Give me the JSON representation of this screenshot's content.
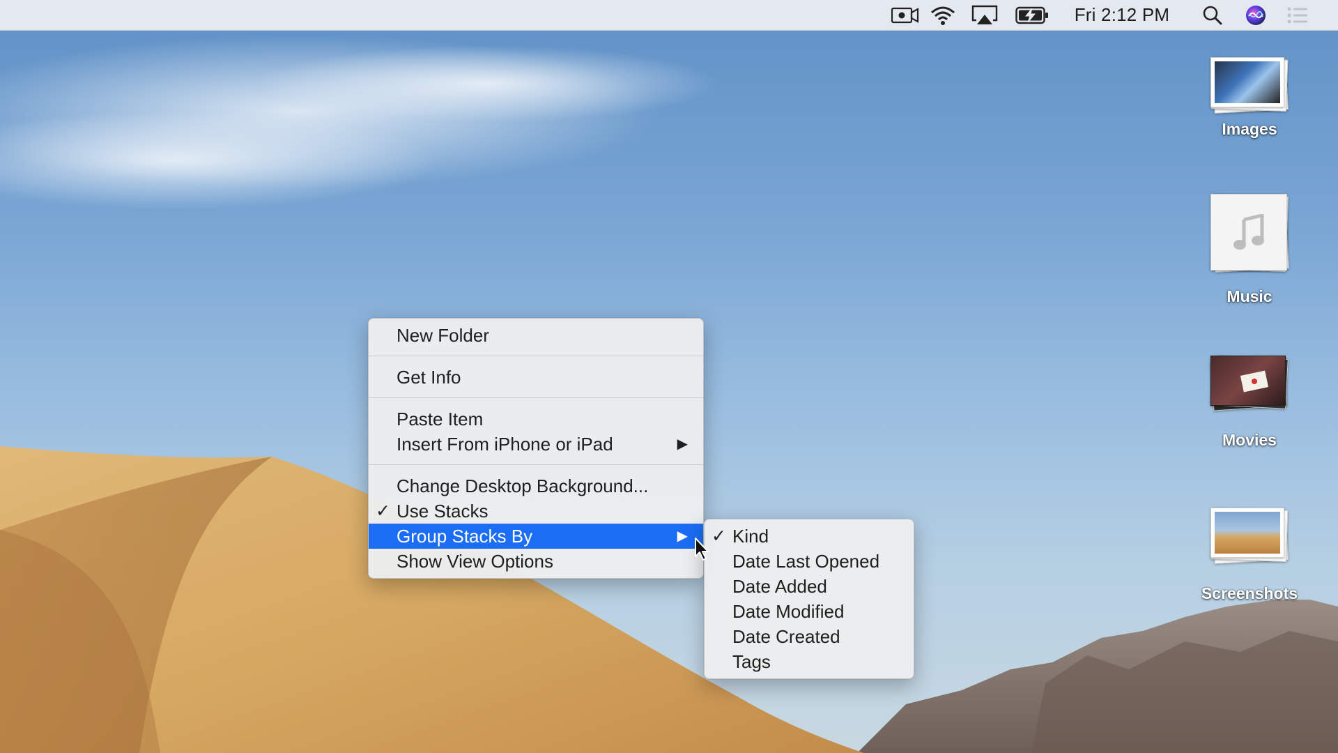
{
  "menubar": {
    "icons": [
      "screen-recording-icon",
      "wifi-icon",
      "airplay-icon",
      "battery-charging-icon",
      "spotlight-search-icon",
      "siri-icon",
      "notification-center-icon"
    ],
    "clock": "Fri 2:12 PM"
  },
  "desktop_stacks": [
    {
      "label": "Images"
    },
    {
      "label": "Music"
    },
    {
      "label": "Movies"
    },
    {
      "label": "Screenshots"
    }
  ],
  "context_menu": {
    "items": [
      {
        "label": "New Folder"
      },
      {
        "label": "Get Info"
      },
      {
        "label": "Paste Item"
      },
      {
        "label": "Insert From iPhone or iPad",
        "submenu_arrow": "▶"
      },
      {
        "label": "Change Desktop Background..."
      },
      {
        "label": "Use Stacks",
        "checked": true,
        "check": "✓"
      },
      {
        "label": "Group Stacks By",
        "highlighted": true,
        "submenu_arrow": "▶"
      },
      {
        "label": "Show View Options"
      }
    ]
  },
  "submenu": {
    "items": [
      {
        "label": "Kind",
        "checked": true,
        "check": "✓"
      },
      {
        "label": "Date Last Opened"
      },
      {
        "label": "Date Added"
      },
      {
        "label": "Date Modified"
      },
      {
        "label": "Date Created"
      },
      {
        "label": "Tags"
      }
    ]
  },
  "colors": {
    "highlight": "#1b6df4",
    "sky_top": "#5f90c6",
    "dune": "#d9ae68"
  }
}
